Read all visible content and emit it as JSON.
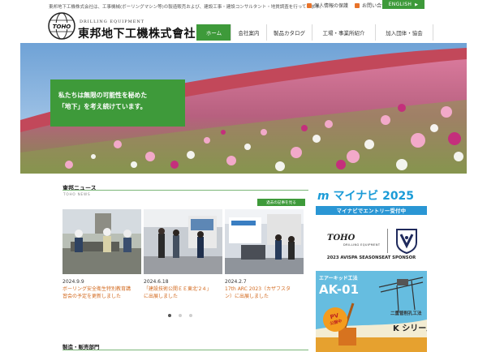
{
  "header": {
    "tagline": "東邦地下工機株式会社は、工事機械(ボーリングマシン等)の製造販売および、建設工事・建設コンサルタント・地質調査を行っています。",
    "top_links": [
      {
        "label": "個人情報の保護"
      },
      {
        "label": "お問い合せ"
      }
    ],
    "english_label": "ENGLISH",
    "logo": {
      "mark_text": "TOHO",
      "sub": "DRILLING EQUIPMENT",
      "name": "東邦地下工機株式會社"
    },
    "nav": [
      {
        "label": "ホーム",
        "active": true
      },
      {
        "label": "会社案内"
      },
      {
        "label": "製品カタログ"
      },
      {
        "label": "工場・事業所紹介"
      },
      {
        "label": "加入団体・協会"
      }
    ]
  },
  "hero": {
    "line1": "私たちは無限の可能性を秘めた",
    "line2": "「地下」を考え続けています。"
  },
  "news": {
    "title": "東邦ニュース",
    "subtitle": "TOHO NEWS",
    "past_button": "過去の記事を見る",
    "items": [
      {
        "date": "2024.9.9",
        "line1": "ボーリング安全衛生特別教育講",
        "line2": "習会の予定を更新しました"
      },
      {
        "date": "2024.6.18",
        "line1": "「建設技術公開ＥＥ東北'2４」",
        "line2": "に出展しました"
      },
      {
        "date": "2024.2.7",
        "line1": "17th ARC 2023（カザフスタ",
        "line2": "ン）に出展しました"
      }
    ]
  },
  "department": {
    "title": "製造・販売部門"
  },
  "banners": {
    "mynavi": {
      "logo": "マイナビ",
      "year": "2025",
      "bar": "マイナビでエントリー受付中"
    },
    "sponsor": {
      "logo": "TOHO",
      "logo_sub": "DRILLING EQUIPMENT",
      "caption": "2023 AVISPA SEASONSEAT SPONSOR"
    },
    "ak01": {
      "top": "エアーキッド工法",
      "model": "AK-01",
      "pv_line1": "PV",
      "pv_line2": "公開中",
      "series_label": "二重管削孔工法",
      "series": "K シリーズ"
    }
  },
  "colors": {
    "accent_green": "#3e9a3a",
    "link_orange": "#d36a1f",
    "mynavi_blue": "#2a96d4"
  }
}
